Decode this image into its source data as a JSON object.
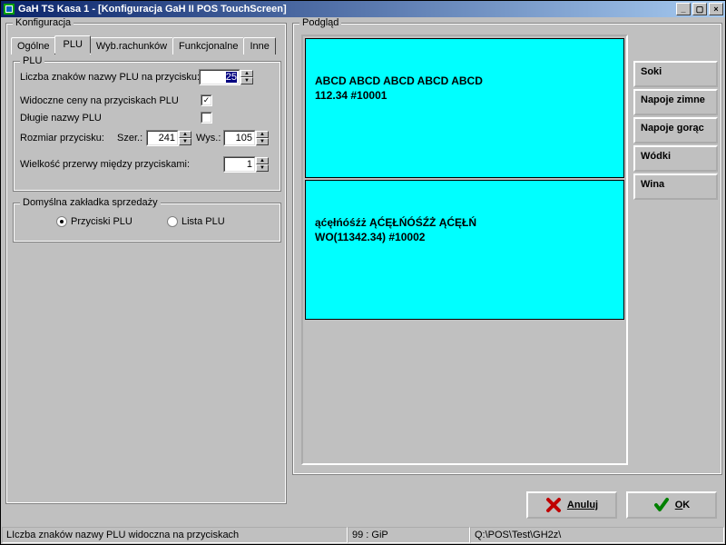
{
  "titlebar": {
    "title": "GaH TS  Kasa 1 - [Konfiguracja GaH II POS TouchScreen]"
  },
  "tabs": {
    "t0": "Ogólne",
    "t1": "PLU",
    "t2": "Wyb.rachunków",
    "t3": "Funkcjonalne",
    "t4": "Inne"
  },
  "config": {
    "group_title": "Konfiguracja",
    "plu_group": "PLU",
    "chars_label": "Liczba znaków nazwy PLU na przycisku:",
    "chars_value": "25",
    "visible_prices": "Widoczne ceny na przyciskach PLU",
    "long_names": "Długie nazwy PLU",
    "btn_size": "Rozmiar przycisku:",
    "szer": "Szer.:",
    "szer_val": "241",
    "wys": "Wys.:",
    "wys_val": "105",
    "gap": "Wielkość przerwy między przyciskami:",
    "gap_val": "1",
    "default_tab_group": "Domyślna zakładka sprzedaży",
    "radio1": "Przyciski PLU",
    "radio2": "Lista PLU"
  },
  "preview": {
    "group_title": "Podgląd",
    "tile1": {
      "line1": "ABCD ABCD ABCD ABCD ABCD",
      "line2": "112.34 #10001"
    },
    "tile2": {
      "line1": "ąćęłńóśźż ĄĆĘŁŃÓŚŹŻ ĄĆĘŁŃ",
      "line2": "WO(11342.34) #10002"
    },
    "sidebar": {
      "s0": "Soki",
      "s1": "Napoje zimne",
      "s2": "Napoje gorąc",
      "s3": "Wódki",
      "s4": "Wina"
    }
  },
  "buttons": {
    "cancel": "Anuluj",
    "ok": "OK"
  },
  "status": {
    "hint": "LIczba znaków nazwy PLU widoczna na przyciskach",
    "ver": "99 : GiP",
    "path": "Q:\\POS\\Test\\GH2z\\"
  }
}
